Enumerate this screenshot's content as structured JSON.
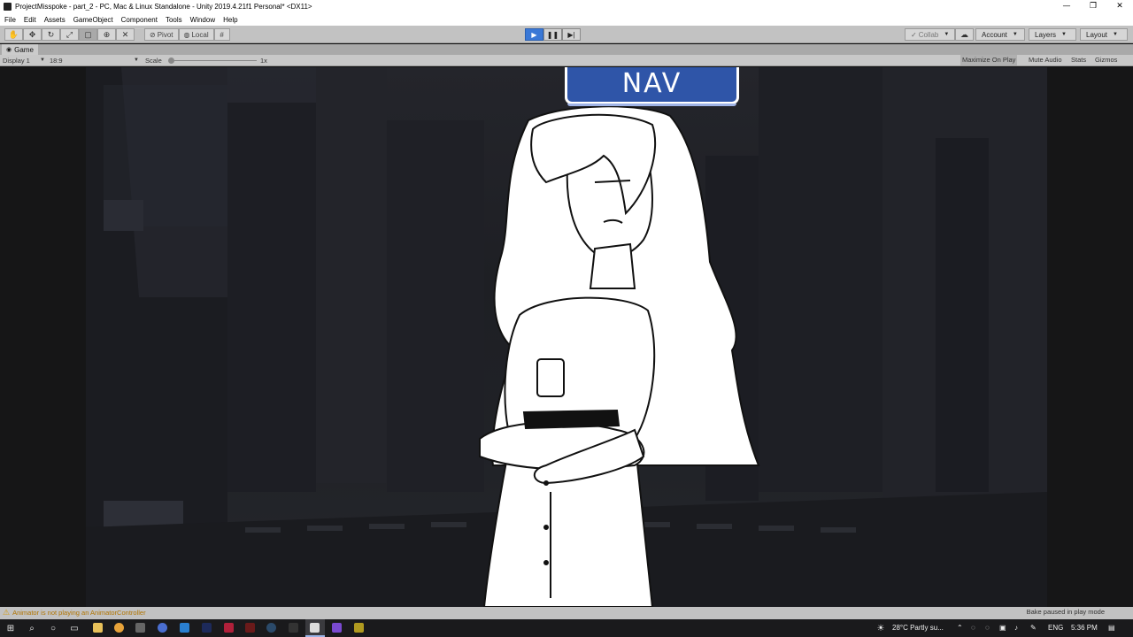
{
  "window": {
    "title": "ProjectMisspoke - part_2 - PC, Mac & Linux Standalone - Unity 2019.4.21f1 Personal* <DX11>",
    "min_label": "—",
    "max_label": "❐",
    "close_label": "✕"
  },
  "menu": [
    "File",
    "Edit",
    "Assets",
    "GameObject",
    "Component",
    "Tools",
    "Window",
    "Help"
  ],
  "toolbar": {
    "pivot_label": "Pivot",
    "local_label": "Local",
    "collab_label": "Collab",
    "account_label": "Account",
    "layers_label": "Layers",
    "layout_label": "Layout",
    "play_state": "playing"
  },
  "game_tab": {
    "tab_label": "Game",
    "display_label": "Display 1",
    "aspect_label": "18:9",
    "scale_label": "Scale",
    "scale_value": "1x",
    "maximize_label": "Maximize On Play",
    "mute_label": "Mute Audio",
    "stats_label": "Stats",
    "gizmos_label": "Gizmos"
  },
  "scene": {
    "sign_text": "NAV",
    "sign_color": "#2f55a8"
  },
  "status": {
    "warning": "Animator is not playing an AnimatorController",
    "bake": "Bake paused in play mode"
  },
  "taskbar": {
    "weather": "28°C  Partly su...",
    "language": "ENG",
    "time": "5:36 PM"
  }
}
